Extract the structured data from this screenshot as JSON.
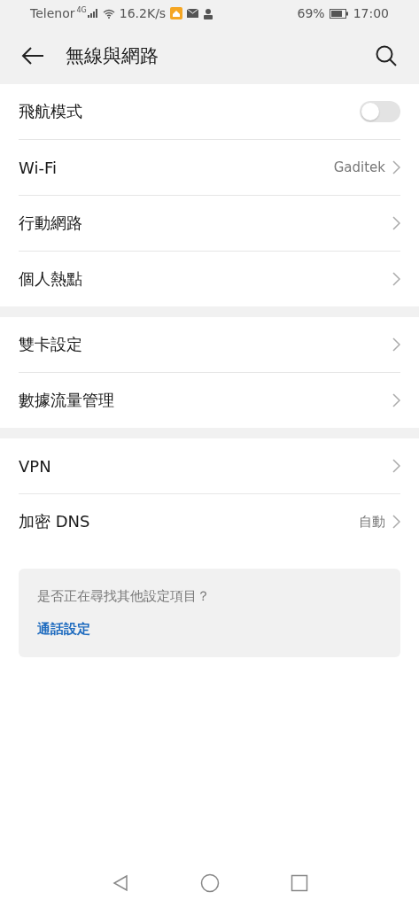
{
  "status_bar": {
    "carrier": "Telenor",
    "network": "4G",
    "speed": "16.2K/s",
    "battery": "69%",
    "time": "17:00"
  },
  "header": {
    "title": "無線與網路"
  },
  "groups": [
    {
      "items": [
        {
          "kind": "switch",
          "label": "飛航模式",
          "on": false
        },
        {
          "kind": "link",
          "label": "Wi-Fi",
          "value": "Gaditek"
        },
        {
          "kind": "link",
          "label": "行動網路"
        },
        {
          "kind": "link",
          "label": "個人熱點"
        }
      ]
    },
    {
      "items": [
        {
          "kind": "link",
          "label": "雙卡設定"
        },
        {
          "kind": "link",
          "label": "數據流量管理"
        }
      ]
    },
    {
      "items": [
        {
          "kind": "link",
          "label": "VPN"
        },
        {
          "kind": "link",
          "label": "加密 DNS",
          "value": "自動"
        }
      ]
    }
  ],
  "suggestion": {
    "question": "是否正在尋找其他設定項目？",
    "link": "通話設定"
  }
}
